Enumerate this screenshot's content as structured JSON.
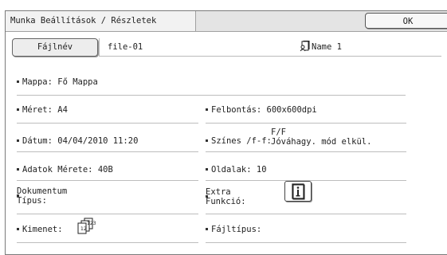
{
  "header": {
    "title": "Munka Beállítások / Részletek",
    "ok_label": "OK"
  },
  "file": {
    "button_label": "Fájlnév",
    "name": "file-01",
    "owner": "Name 1",
    "owner_icon": "document-user-icon"
  },
  "details": {
    "folder": "Mappa: Fő Mappa",
    "size": "Méret: A4",
    "resolution": "Felbontás: 600x600dpi",
    "date": "Dátum: 04/04/2010 11:20",
    "color_label": "Színes /f-f:",
    "color_value_line1": "F/F",
    "color_value_line2": "Jóváhagy. mód elkül.",
    "data_size": "Adatok Mérete: 40B",
    "pages": "Oldalak: 10",
    "doc_type_line1": "Dokumentum",
    "doc_type_line2": "Típus:",
    "extra_line1": "Extra",
    "extra_line2": "Funkció:",
    "extra_icon": "info-icon",
    "output_label": "Kimenet:",
    "output_icon": "collate-pages-icon",
    "file_type": "Fájltípus:"
  }
}
